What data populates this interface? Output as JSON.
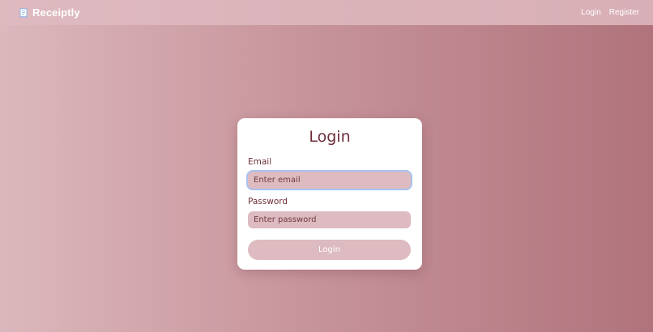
{
  "navbar": {
    "brand_name": "Receiptly",
    "brand_icon": "receipt-icon",
    "links": {
      "login": "Login",
      "register": "Register"
    }
  },
  "login_form": {
    "title": "Login",
    "email": {
      "label": "Email",
      "placeholder": "Enter email"
    },
    "password": {
      "label": "Password",
      "placeholder": "Enter password"
    },
    "submit_label": "Login"
  },
  "colors": {
    "accent": "#6e2f3a",
    "input_bg": "#ddbbc0",
    "focus_ring": "#a9c2f0",
    "gradient_start": "#dbb8bd",
    "gradient_end": "#b0737c"
  }
}
